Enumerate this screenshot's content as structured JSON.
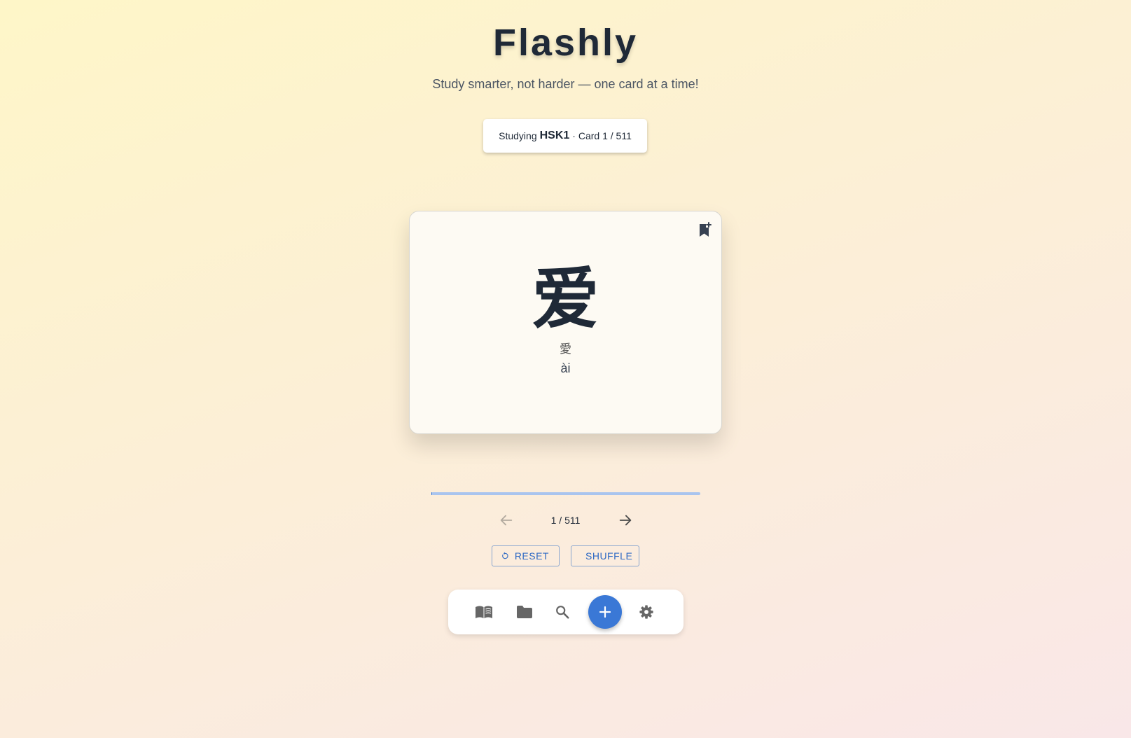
{
  "app": {
    "title": "Flashly",
    "subtitle": "Study smarter, not harder — one card at a time!"
  },
  "deck_status": {
    "prefix": "Studying",
    "deck_name": "HSK1",
    "card_label": "· Card 1 / 511"
  },
  "card": {
    "hanzi": "爱",
    "traditional": "愛",
    "pinyin": "ài",
    "bookmark_icon": "bookmark-add-icon"
  },
  "progress": {
    "current": 1,
    "total": 511,
    "fraction": 0.002
  },
  "pager": {
    "count_text": "1 / 511",
    "prev_icon": "arrow-left-icon",
    "next_icon": "arrow-right-icon"
  },
  "actions": {
    "reset_label": "RESET",
    "shuffle_label": "SHUFFLE"
  },
  "nav": {
    "items": [
      "book-icon",
      "folder-icon",
      "search-icon",
      "add-icon",
      "settings-icon"
    ]
  },
  "colors": {
    "accent": "#3a78d6",
    "text": "#1f2937",
    "icon_gray": "#666666"
  }
}
